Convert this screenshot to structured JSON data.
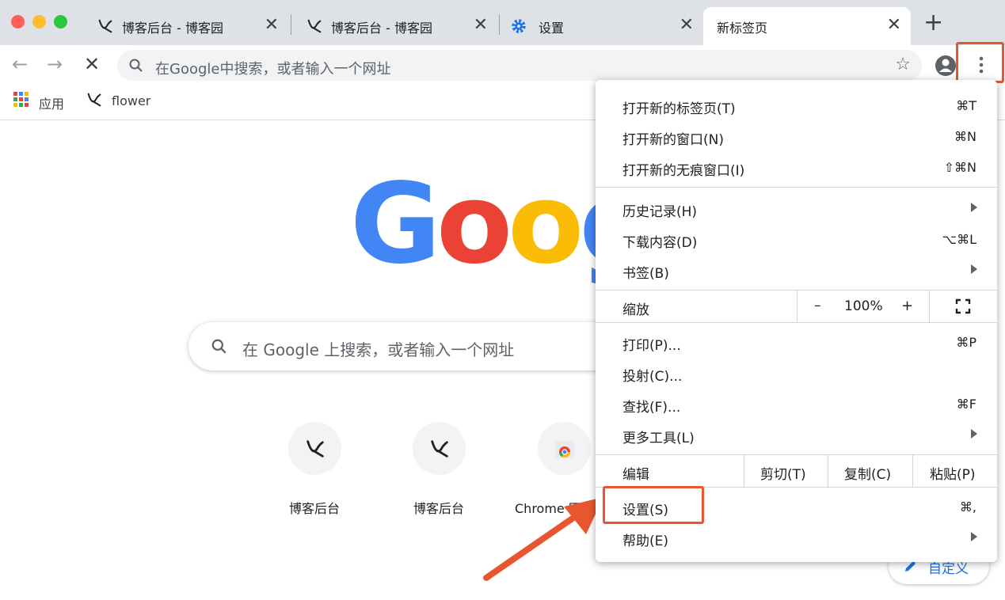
{
  "tabs": [
    {
      "title": "博客后台 - 博客园"
    },
    {
      "title": "博客后台 - 博客园"
    },
    {
      "title": "设置"
    },
    {
      "title": "新标签页"
    }
  ],
  "omnibox": {
    "placeholder": "在Google中搜索，或者输入一个网址"
  },
  "bookmarks": [
    {
      "label": "应用"
    },
    {
      "label": "flower"
    }
  ],
  "ntp": {
    "search_placeholder": "在 Google 上搜索，或者输入一个网址",
    "shortcuts": [
      {
        "label": "博客后台"
      },
      {
        "label": "博客后台"
      },
      {
        "label": "Chrome 网"
      }
    ],
    "customize_label": "自定义"
  },
  "menu": {
    "new_tab": {
      "label": "打开新的标签页(T)",
      "shortcut": "⌘T"
    },
    "new_window": {
      "label": "打开新的窗口(N)",
      "shortcut": "⌘N"
    },
    "incognito": {
      "label": "打开新的无痕窗口(I)",
      "shortcut": "⇧⌘N"
    },
    "history": {
      "label": "历史记录(H)"
    },
    "downloads": {
      "label": "下载内容(D)",
      "shortcut": "⌥⌘L"
    },
    "bookmarks": {
      "label": "书签(B)"
    },
    "zoom": {
      "label": "缩放",
      "minus": "–",
      "value": "100%",
      "plus": "+"
    },
    "print": {
      "label": "打印(P)...",
      "shortcut": "⌘P"
    },
    "cast": {
      "label": "投射(C)..."
    },
    "find": {
      "label": "查找(F)...",
      "shortcut": "⌘F"
    },
    "more_tools": {
      "label": "更多工具(L)"
    },
    "edit": {
      "label": "编辑",
      "cut": "剪切(T)",
      "copy": "复制(C)",
      "paste": "粘贴(P)"
    },
    "settings": {
      "label": "设置(S)",
      "shortcut": "⌘,"
    },
    "help": {
      "label": "帮助(E)"
    }
  },
  "colors": {
    "accent": "#1a73e8",
    "highlight": "#e8562f"
  }
}
